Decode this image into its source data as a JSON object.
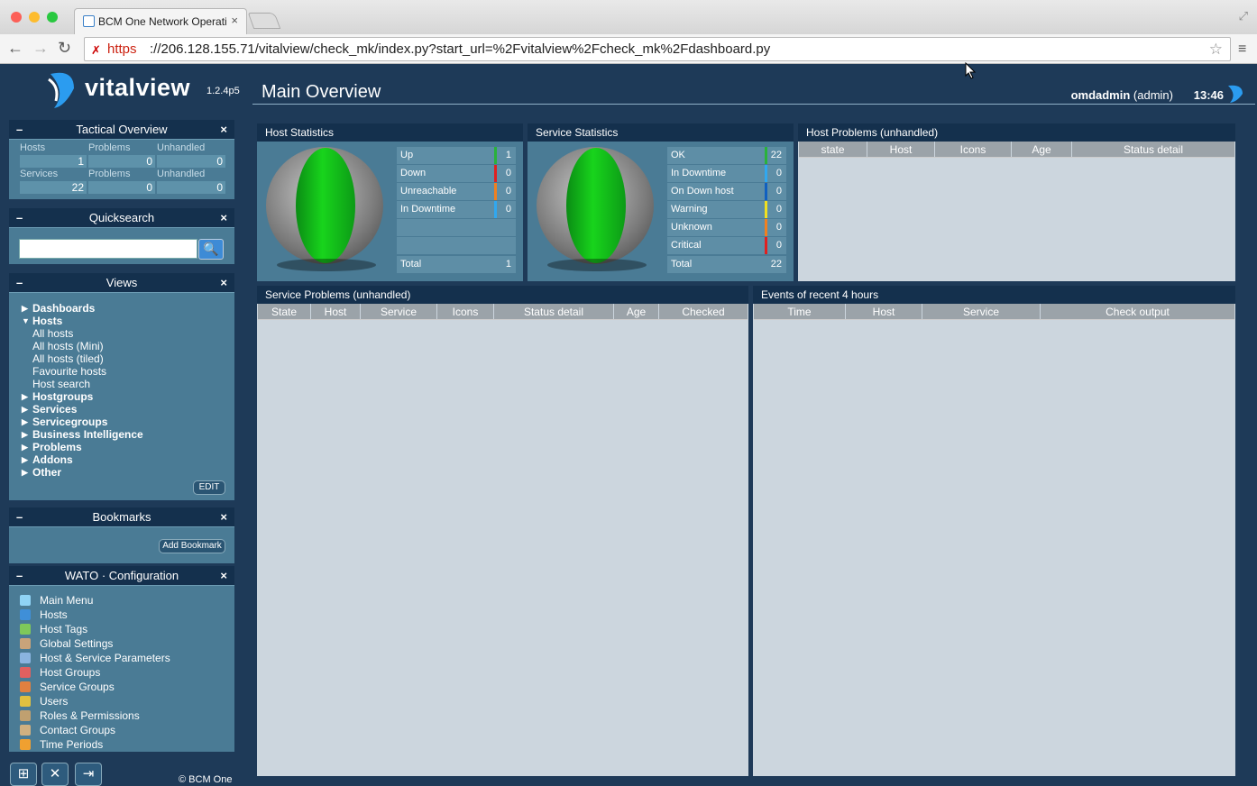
{
  "browser": {
    "tab_title": "BCM One Network Operati",
    "tab_close": "×",
    "url_scheme": "https",
    "url_rest": "://206.128.155.71/vitalview/check_mk/index.py?start_url=%2Fvitalview%2Fcheck_mk%2Fdashboard.py",
    "url_full": "https://206.128.155.71/vitalview/check_mk/index.py?start_url=%2Fvitalview%2Fcheck_mk%2Fdashboard.py",
    "back": "←",
    "forward": "→",
    "reload": "↻",
    "star": "☆",
    "menu": "≡",
    "resize": "⤢",
    "colors": {
      "close": "#fc5f57",
      "minimize": "#fdbc2e",
      "maximize": "#29c840"
    }
  },
  "sidebar": {
    "logo_text": "vitalview",
    "version": "1.2.4p5",
    "tactical": {
      "title": "Tactical Overview",
      "min": "–",
      "close": "×",
      "rows": [
        {
          "labels": [
            "Hosts",
            "Problems",
            "Unhandled"
          ],
          "values": [
            "1",
            "0",
            "0"
          ]
        },
        {
          "labels": [
            "Services",
            "Problems",
            "Unhandled"
          ],
          "values": [
            "22",
            "0",
            "0"
          ]
        }
      ]
    },
    "quicksearch": {
      "title": "Quicksearch",
      "min": "–",
      "close": "×",
      "button": "🔍",
      "value": ""
    },
    "views": {
      "title": "Views",
      "min": "–",
      "close": "×",
      "items": [
        {
          "label": "Dashboards",
          "arrow": "▶"
        },
        {
          "label": "Hosts",
          "arrow": "▼",
          "sub": [
            "All hosts",
            "All hosts (Mini)",
            "All hosts (tiled)",
            "Favourite hosts",
            "Host search"
          ]
        },
        {
          "label": "Hostgroups",
          "arrow": "▶"
        },
        {
          "label": "Services",
          "arrow": "▶"
        },
        {
          "label": "Servicegroups",
          "arrow": "▶"
        },
        {
          "label": "Business Intelligence",
          "arrow": "▶"
        },
        {
          "label": "Problems",
          "arrow": "▶"
        },
        {
          "label": "Addons",
          "arrow": "▶"
        },
        {
          "label": "Other",
          "arrow": "▶"
        }
      ],
      "edit": "EDIT"
    },
    "bookmarks": {
      "title": "Bookmarks",
      "min": "–",
      "close": "×",
      "add": "Add Bookmark"
    },
    "wato": {
      "title": "WATO · Configuration",
      "min": "–",
      "close": "×",
      "items": [
        {
          "label": "Main Menu",
          "icon": "home-icon",
          "color": "#8fd3f5"
        },
        {
          "label": "Hosts",
          "icon": "folder-icon",
          "color": "#3f8fd8"
        },
        {
          "label": "Host Tags",
          "icon": "tag-icon",
          "color": "#7fc85a"
        },
        {
          "label": "Global Settings",
          "icon": "settings-icon",
          "color": "#c8a37a"
        },
        {
          "label": "Host & Service Parameters",
          "icon": "rules-icon",
          "color": "#8ab4e0"
        },
        {
          "label": "Host Groups",
          "icon": "hostgroups-icon",
          "color": "#e06060"
        },
        {
          "label": "Service Groups",
          "icon": "servicegroups-icon",
          "color": "#e08040"
        },
        {
          "label": "Users",
          "icon": "users-icon",
          "color": "#e0c040"
        },
        {
          "label": "Roles & Permissions",
          "icon": "roles-icon",
          "color": "#c0a070"
        },
        {
          "label": "Contact Groups",
          "icon": "contactgroups-icon",
          "color": "#d0b080"
        },
        {
          "label": "Time Periods",
          "icon": "clock-icon",
          "color": "#f0a030"
        }
      ]
    },
    "footer": {
      "copyright": "© BCM One",
      "btn1": "⊞",
      "btn2": "✕",
      "btn3": "⇥"
    }
  },
  "main": {
    "title": "Main Overview",
    "user": "omdadmin",
    "role": "(admin)",
    "time": "13:46",
    "host_stats": {
      "title": "Host Statistics",
      "rows": [
        {
          "label": "Up",
          "value": "1",
          "color": "#29b23b"
        },
        {
          "label": "Down",
          "value": "0",
          "color": "#e02020"
        },
        {
          "label": "Unreachable",
          "value": "0",
          "color": "#f08020"
        },
        {
          "label": "In Downtime",
          "value": "0",
          "color": "#30a8f0"
        },
        {
          "label": "",
          "value": "",
          "color": ""
        },
        {
          "label": "",
          "value": "",
          "color": ""
        }
      ],
      "total_label": "Total",
      "total": "1"
    },
    "service_stats": {
      "title": "Service Statistics",
      "rows": [
        {
          "label": "OK",
          "value": "22",
          "color": "#29b23b"
        },
        {
          "label": "In Downtime",
          "value": "0",
          "color": "#30a8f0"
        },
        {
          "label": "On Down host",
          "value": "0",
          "color": "#1060c0"
        },
        {
          "label": "Warning",
          "value": "0",
          "color": "#f0e020"
        },
        {
          "label": "Unknown",
          "value": "0",
          "color": "#f08020"
        },
        {
          "label": "Critical",
          "value": "0",
          "color": "#e02020"
        }
      ],
      "total_label": "Total",
      "total": "22"
    },
    "host_problems": {
      "title": "Host Problems (unhandled)",
      "cols": [
        "state",
        "Host",
        "Icons",
        "Age",
        "Status detail"
      ]
    },
    "service_problems": {
      "title": "Service Problems (unhandled)",
      "cols": [
        "State",
        "Host",
        "Service",
        "Icons",
        "Status detail",
        "Age",
        "Checked"
      ]
    },
    "events": {
      "title": "Events of recent 4 hours",
      "cols": [
        "Time",
        "Host",
        "Service",
        "Check output"
      ]
    }
  }
}
